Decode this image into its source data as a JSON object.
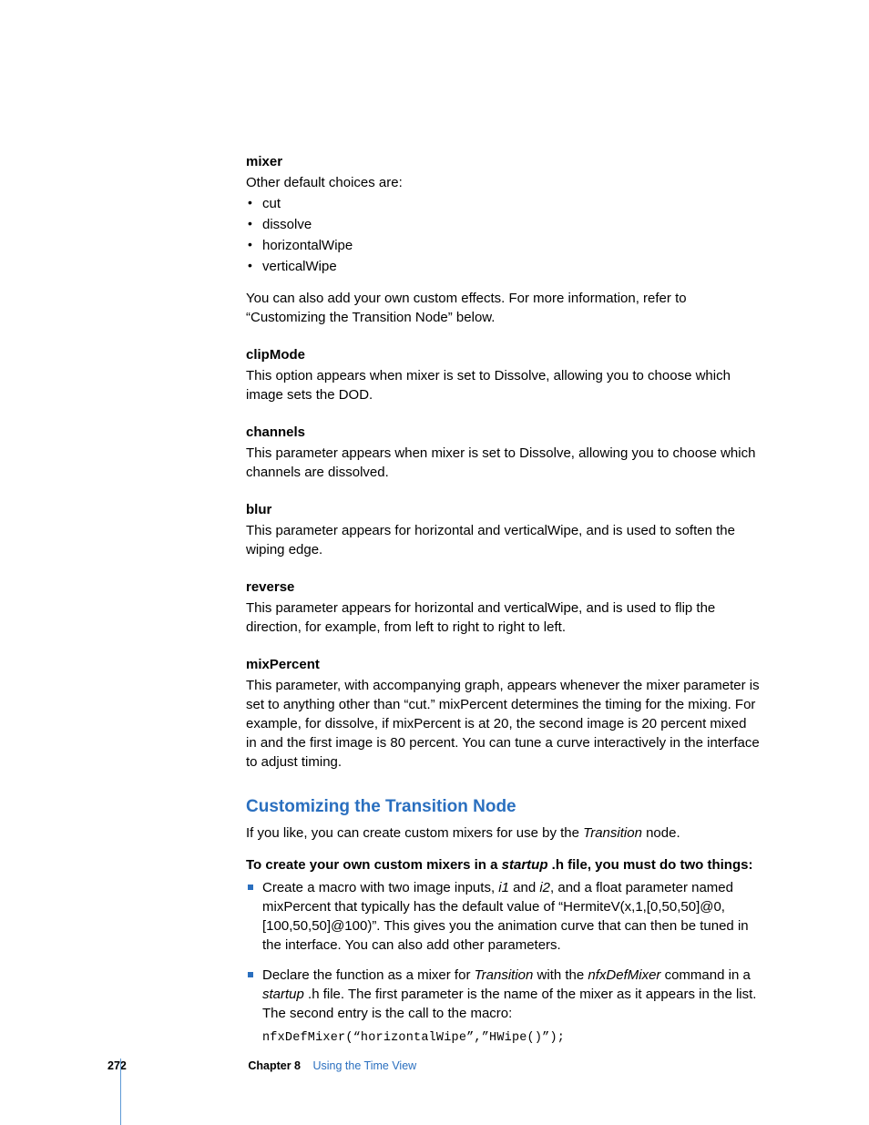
{
  "mixer": {
    "heading": "mixer",
    "intro": "Other default choices are:",
    "bullets": [
      "cut",
      "dissolve",
      "horizontalWipe",
      "verticalWipe"
    ],
    "note": "You can also add your own custom effects. For more information, refer to “Customizing the Transition Node” below."
  },
  "clipMode": {
    "heading": "clipMode",
    "body": "This option appears when mixer is set to Dissolve, allowing you to choose which image sets the DOD."
  },
  "channels": {
    "heading": "channels",
    "body": "This parameter appears when mixer is set to Dissolve, allowing you to choose which channels are dissolved."
  },
  "blur": {
    "heading": "blur",
    "body": "This parameter appears for horizontal and verticalWipe, and is used to soften the wiping edge."
  },
  "reverse": {
    "heading": "reverse",
    "body": "This parameter appears for horizontal and verticalWipe, and is used to flip the direction, for example, from left to right to right to left."
  },
  "mixPercent": {
    "heading": "mixPercent",
    "body": "This parameter, with accompanying graph, appears whenever the mixer parameter is set to anything other than “cut.” mixPercent determines the timing for the mixing. For example, for dissolve, if mixPercent is at 20, the second image is 20 percent mixed in and the first image is 80 percent. You can tune a curve interactively in the interface to adjust timing."
  },
  "section": {
    "title": "Customizing the Transition Node",
    "intro_pre": "If you like, you can create custom mixers for use by the ",
    "intro_it": "Transition",
    "intro_post": " node.",
    "lead_a": "To create your own custom mixers in a ",
    "lead_it": "startup",
    "lead_b": " .h file, you must do two things:",
    "step1_a": "Create a macro with two image inputs, ",
    "step1_i1": "i1",
    "step1_b": " and ",
    "step1_i2": "i2",
    "step1_c": ", and a float parameter named mixPercent that typically has the default value of “HermiteV(x,1,[0,50,50]@0,[100,50,50]@100)”. This gives you the animation curve that can then be tuned in the interface. You can also add other parameters.",
    "step2_a": "Declare the function as a mixer for ",
    "step2_it1": "Transition",
    "step2_b": " with the ",
    "step2_it2": "nfxDefMixer",
    "step2_c": " command in a ",
    "step2_it3": "startup",
    "step2_d": " .h file. The first parameter is the name of the mixer as it appears in the list. The second entry is the call to the macro:",
    "code": "nfxDefMixer(“horizontalWipe”,”HWipe()”);"
  },
  "footer": {
    "page": "272",
    "chapter": "Chapter 8",
    "title": "Using the Time View"
  }
}
